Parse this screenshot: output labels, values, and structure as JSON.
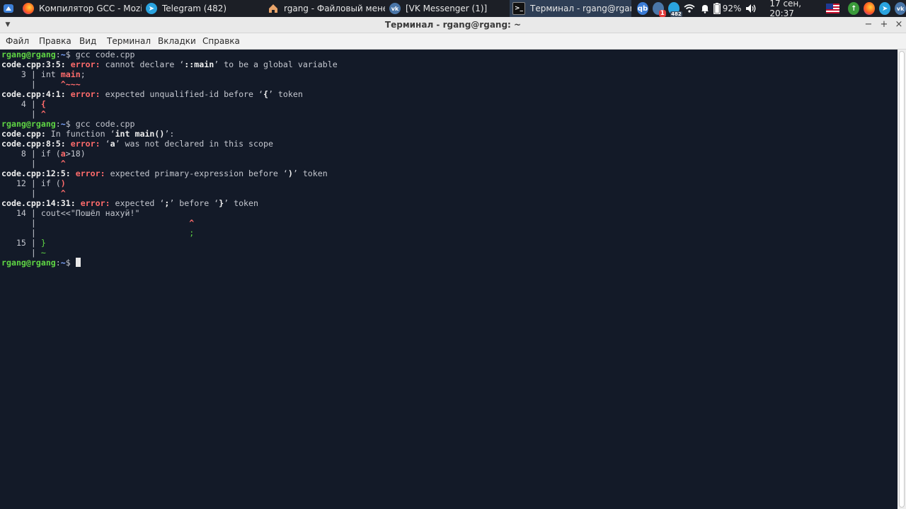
{
  "taskbar": {
    "tasks": [
      {
        "label": "Компилятор GCC - Mozil..."
      },
      {
        "label": "Telegram (482)"
      },
      {
        "label": "rgang - Файловый мене..."
      },
      {
        "label": "[VK Messenger (1)]"
      },
      {
        "label": "Терминал - rgang@rgan..."
      }
    ],
    "tray": {
      "qbittorrent_label": "qb",
      "vk_badge": "1",
      "telegram_badge": "482",
      "battery": "92%",
      "clock": "17 сен, 20:37"
    }
  },
  "window": {
    "title": "Терминал - rgang@rgang: ~",
    "controls": {
      "minimize": "−",
      "maximize": "+",
      "close": "×"
    }
  },
  "menu": [
    "Файл",
    "Правка",
    "Вид",
    "Терминал",
    "Вкладки",
    "Справка"
  ],
  "terminal": {
    "prompt": {
      "user": "rgang@rgang",
      "sep": ":",
      "path": "~",
      "sym": "$ "
    },
    "cmd1": "gcc code.cpp",
    "e1": {
      "loc": "code.cpp:3:5:",
      "kw": "error:",
      "t1": " cannot declare ‘",
      "b": "::main",
      "t2": "’ to be a global variable"
    },
    "s1": {
      "gut": "    3 | ",
      "code_pre": "int ",
      "code_hl": "main",
      "code_post": ";"
    },
    "m1": {
      "gut": "      | ",
      "pad": "    ",
      "caret": "^~~~"
    },
    "e2": {
      "loc": "code.cpp:4:1:",
      "kw": "error:",
      "t1": " expected unqualified-id before ‘",
      "b": "{",
      "t2": "’ token"
    },
    "s2": {
      "gut": "    4 | ",
      "code_hl": "{"
    },
    "m2": {
      "gut": "      | ",
      "caret": "^"
    },
    "cmd2": "gcc code.cpp",
    "f1": {
      "loc": "code.cpp:",
      "t1": " In function ‘",
      "b": "int main()",
      "t2": "’:"
    },
    "e3": {
      "loc": "code.cpp:8:5:",
      "kw": "error:",
      "t1": " ‘",
      "b": "a",
      "t2": "’ was not declared in this scope"
    },
    "s3": {
      "gut": "    8 | ",
      "code_pre": "if (",
      "code_hl": "a",
      "code_post": ">18)"
    },
    "m3": {
      "gut": "      | ",
      "pad": "    ",
      "caret": "^"
    },
    "e4": {
      "loc": "code.cpp:12:5:",
      "kw": "error:",
      "t1": " expected primary-expression before ‘",
      "b": ")",
      "t2": "’ token"
    },
    "s4": {
      "gut": "   12 | ",
      "code_pre": "if (",
      "code_hl": ")"
    },
    "m4": {
      "gut": "      | ",
      "pad": "    ",
      "caret": "^"
    },
    "e5": {
      "loc": "code.cpp:14:31:",
      "kw": "error:",
      "t1": " expected ‘",
      "b1": ";",
      "t2": "’ before ‘",
      "b2": "}",
      "t3": "’ token"
    },
    "s5": {
      "gut": "   14 | ",
      "code": "cout<<\"Пошёл нахуй!\""
    },
    "m5": {
      "gut": "      | ",
      "pad": "                              ",
      "caret": "^"
    },
    "m5b": {
      "gut": "      | ",
      "pad": "                              ",
      "fix": ";"
    },
    "s6": {
      "gut": "   15 | ",
      "code_fix": "}"
    },
    "m6": {
      "gut": "      | ",
      "fix": "~"
    }
  },
  "colors": {
    "terminal_bg": "#131a28",
    "prompt_user": "#5fd544",
    "prompt_path": "#7fa6ff",
    "error": "#ff6b6b",
    "fixit": "#5fd544"
  }
}
